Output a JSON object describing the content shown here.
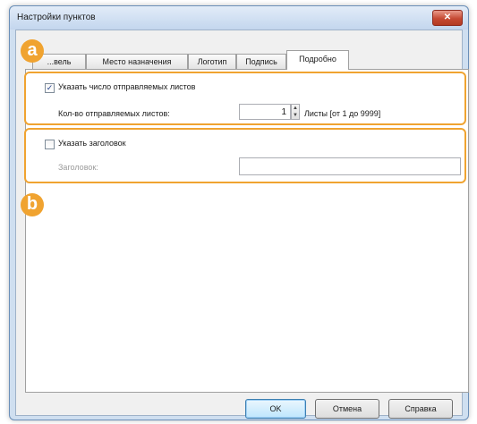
{
  "dialog": {
    "title": "Настройки пунктов",
    "close_label": "✕"
  },
  "tabs": [
    {
      "label": "...вель"
    },
    {
      "label": "Место назначения"
    },
    {
      "label": "Логотип"
    },
    {
      "label": "Подпись"
    },
    {
      "label": "Подробно",
      "active": true
    }
  ],
  "section_a": {
    "badge": "a",
    "checkbox_label": "Указать число отправляемых листов",
    "checked": true,
    "count_label": "Кол-во отправляемых листов:",
    "count_value": "1",
    "count_suffix": "Листы [от 1 до 9999]"
  },
  "section_b": {
    "badge": "b",
    "checkbox_label": "Указать заголовок",
    "checked": false,
    "title_label": "Заголовок:",
    "title_value": ""
  },
  "buttons": {
    "ok": "OK",
    "cancel": "Отмена",
    "help": "Справка"
  },
  "colors": {
    "highlight": "#f0a330",
    "close_button": "#c64a33"
  }
}
